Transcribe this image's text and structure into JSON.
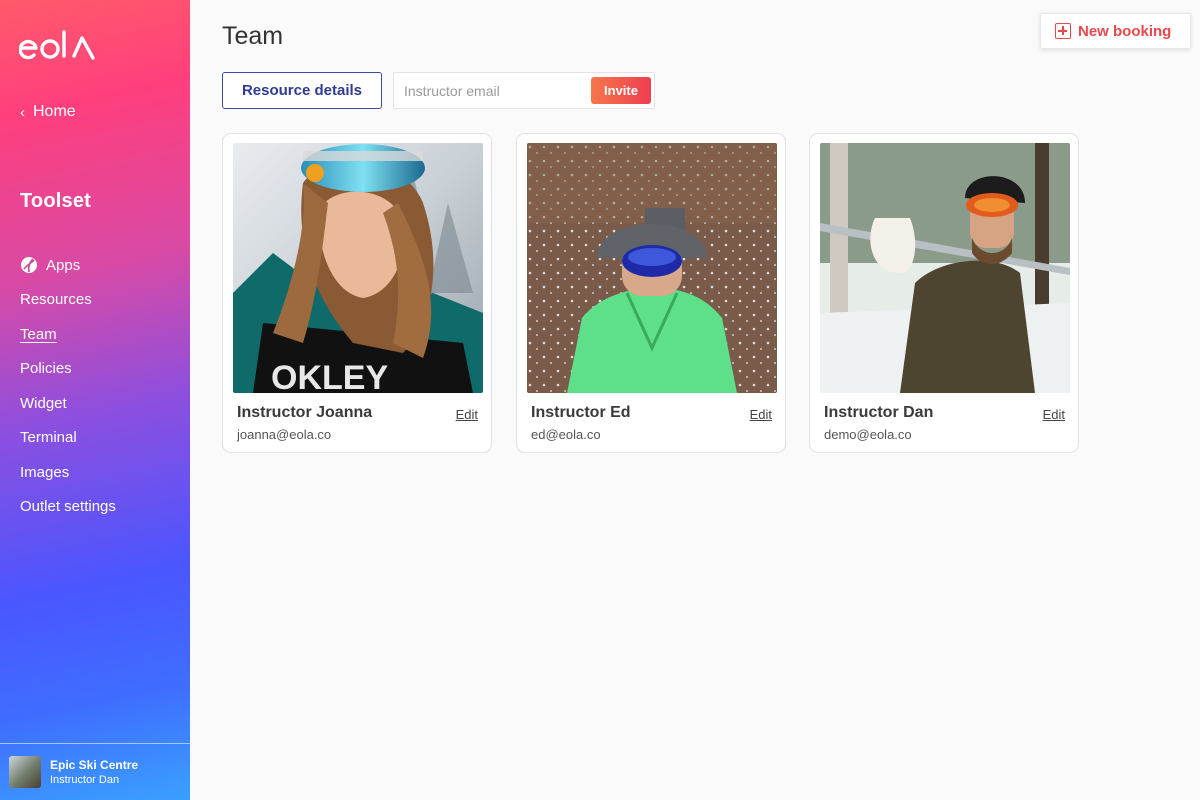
{
  "sidebar": {
    "logo_text": "eola",
    "home_label": "Home",
    "section_title": "Toolset",
    "items": [
      {
        "label": "Apps",
        "icon": "apps-icon"
      },
      {
        "label": "Resources"
      },
      {
        "label": "Team",
        "active": true
      },
      {
        "label": "Policies"
      },
      {
        "label": "Widget"
      },
      {
        "label": "Terminal"
      },
      {
        "label": "Images"
      },
      {
        "label": "Outlet settings"
      }
    ],
    "account": {
      "org": "Epic Ski Centre",
      "user": "Instructor Dan"
    }
  },
  "header": {
    "title": "Team",
    "new_booking_label": "New booking"
  },
  "toolbar": {
    "resource_details_label": "Resource details",
    "invite_placeholder": "Instructor email",
    "invite_label": "Invite"
  },
  "team": [
    {
      "name": "Instructor Joanna",
      "email": "joanna@eola.co",
      "edit_label": "Edit"
    },
    {
      "name": "Instructor Ed",
      "email": "ed@eola.co",
      "edit_label": "Edit"
    },
    {
      "name": "Instructor Dan",
      "email": "demo@eola.co",
      "edit_label": "Edit"
    }
  ],
  "colors": {
    "accent": "#e8474d",
    "primary_blue": "#3b4aa6"
  }
}
